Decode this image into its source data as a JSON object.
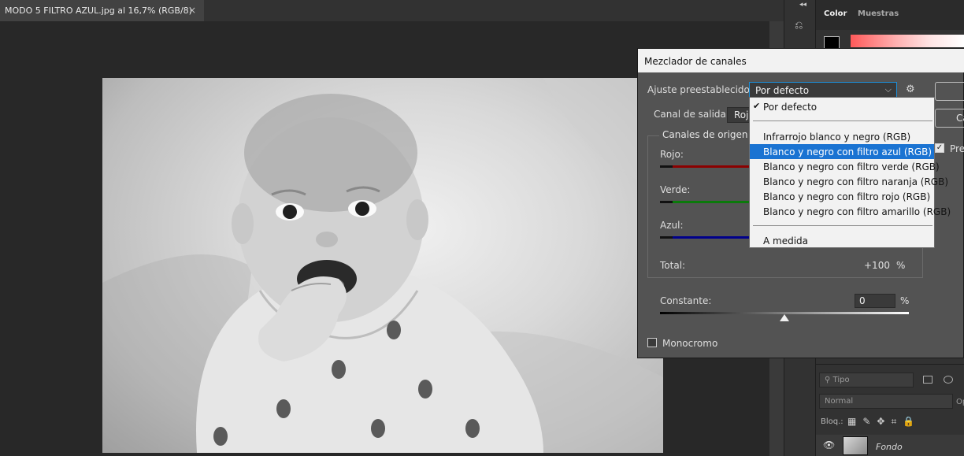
{
  "document": {
    "tab_title": "MODO 5 FILTRO AZUL.jpg al 16,7% (RGB/8)",
    "close_glyph": "×"
  },
  "right_panel": {
    "tabs": [
      "Color",
      "Muestras"
    ],
    "layers": {
      "filter_placeholder": "Tipo",
      "blend_mode": "Normal",
      "opacity_label_fragment": "Op",
      "lock_label": "Bloq.:",
      "layer_name": "Fondo"
    }
  },
  "dialog": {
    "title": "Mezclador de canales",
    "preset_label": "Ajuste preestablecido:",
    "preset_value": "Por defecto",
    "output_label": "Canal de salida:",
    "output_value": "Roj",
    "ok_fragment": "",
    "cancel_fragment": "Ca",
    "preview_fragment": "Pre",
    "source_group_label": "Canales de origen",
    "channels": [
      {
        "label": "Rojo:",
        "color": "#8b0000"
      },
      {
        "label": "Verde:",
        "color": "#0a7a0a"
      },
      {
        "label": "Azul:",
        "color": "#00008b"
      }
    ],
    "total_label": "Total:",
    "total_value": "+100",
    "percent_sign": "%",
    "constant_label": "Constante:",
    "constant_value": "0",
    "monochrome_label": "Monocromo",
    "monochrome_checked": false
  },
  "preset_dropdown": {
    "items": [
      {
        "label": "Por defecto",
        "checked": true,
        "selected": false
      },
      {
        "label": "Infrarrojo blanco y negro (RGB)",
        "checked": false,
        "selected": false
      },
      {
        "label": "Blanco y negro con filtro azul (RGB)",
        "checked": false,
        "selected": true
      },
      {
        "label": "Blanco y negro con filtro verde (RGB)",
        "checked": false,
        "selected": false
      },
      {
        "label": "Blanco y negro con filtro naranja (RGB)",
        "checked": false,
        "selected": false
      },
      {
        "label": "Blanco y negro con filtro rojo (RGB)",
        "checked": false,
        "selected": false
      },
      {
        "label": "Blanco y negro con filtro amarillo (RGB)",
        "checked": false,
        "selected": false
      },
      {
        "label": "A medida",
        "checked": false,
        "selected": false
      }
    ],
    "check_glyph": "✔"
  },
  "icons": {
    "history": "history-icon",
    "gear": "gear-icon",
    "eye": "eye-icon",
    "chevron": "chevron-down-icon"
  }
}
